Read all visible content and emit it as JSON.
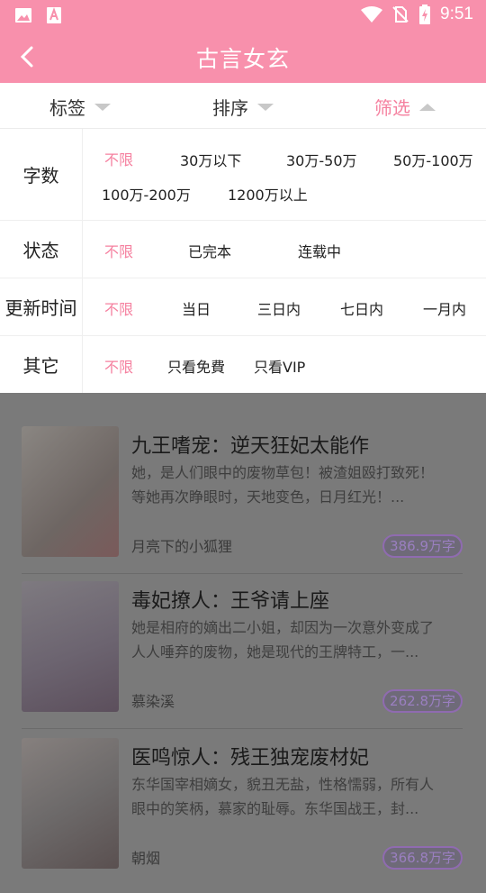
{
  "status_bar": {
    "time": "9:51",
    "icons": [
      "image-icon",
      "font-app-icon",
      "wifi-icon",
      "no-sim-icon",
      "battery-charging-icon"
    ]
  },
  "header": {
    "title": "古言女玄"
  },
  "tabs": [
    {
      "label": "标签"
    },
    {
      "label": "排序"
    },
    {
      "label": "筛选"
    }
  ],
  "filters": {
    "word_count": {
      "label": "字数",
      "options": [
        "不限",
        "30万以下",
        "30万-50万",
        "50万-100万",
        "100万-200万",
        "1200万以上"
      ],
      "selected": "不限"
    },
    "status": {
      "label": "状态",
      "options": [
        "不限",
        "已完本",
        "连载中"
      ],
      "selected": "不限"
    },
    "update_time": {
      "label": "更新时间",
      "options": [
        "不限",
        "当日",
        "三日内",
        "七日内",
        "一月内"
      ],
      "selected": "不限"
    },
    "other": {
      "label": "其它",
      "options": [
        "不限",
        "只看免費",
        "只看VIP"
      ],
      "selected": "不限"
    }
  },
  "books": [
    {
      "title": "九王嗜宠：逆天狂妃太能作",
      "desc": "她，是人们眼中的废物草包！被渣姐殴打致死！等她再次睁眼时，天地变色，日月红光！...",
      "author": "月亮下的小狐狸",
      "words": "386.9万字"
    },
    {
      "title": "毒妃撩人：王爷请上座",
      "desc": "她是相府的嫡出二小姐，却因为一次意外变成了人人唾弃的废物，她是现代的王牌特工，一...",
      "author": "慕染溪",
      "words": "262.8万字"
    },
    {
      "title": "医鸣惊人：残王独宠废材妃",
      "desc": "东华国宰相嫡女，貌丑无盐，性格懦弱，所有人眼中的笑柄，慕家的耻辱。东华国战王，封...",
      "author": "朝烟",
      "words": "366.8万字"
    }
  ],
  "colors": {
    "accent": "#f890ac",
    "selected_text": "#f5809f",
    "overlay": "#7a7a7a"
  }
}
